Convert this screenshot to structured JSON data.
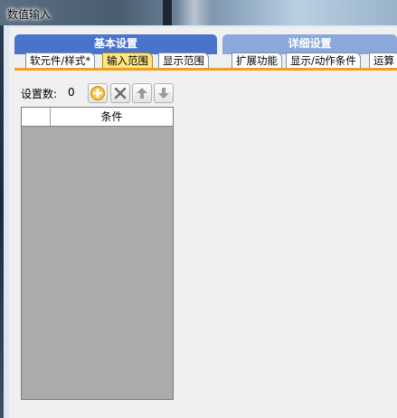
{
  "window": {
    "title": "数值输入"
  },
  "tab_groups": {
    "basic": {
      "label": "基本设置",
      "tabs": [
        "软元件/样式*",
        "输入范围",
        "显示范围"
      ],
      "active": "输入范围"
    },
    "detail": {
      "label": "详细设置",
      "tabs": [
        "扩展功能",
        "显示/动作条件",
        "运算"
      ]
    }
  },
  "settings": {
    "count_label": "设置数:",
    "count_value": "0"
  },
  "toolbar": {
    "icons": [
      "add-icon",
      "delete-icon",
      "move-up-icon",
      "move-down-icon"
    ]
  },
  "grid": {
    "columns": [
      "",
      "条件"
    ],
    "rows": []
  },
  "colors": {
    "basic_group": "#4a73cc",
    "detail_group": "#8aa8dc",
    "active_tab": "#ffe680",
    "accent_line": "#f0a020",
    "grid_empty": "#ababab"
  }
}
